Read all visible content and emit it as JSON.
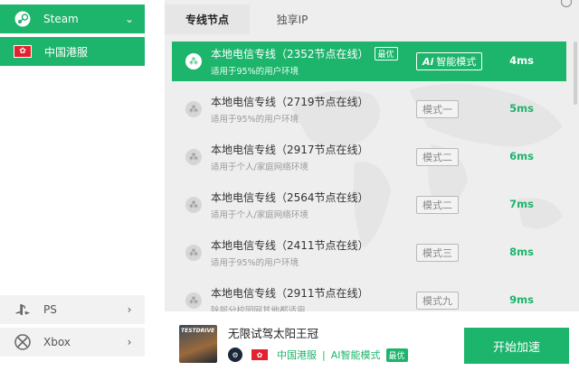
{
  "sidebar": {
    "items": [
      {
        "label": "Steam",
        "icon": "steam-icon",
        "chevron": "⌄"
      },
      {
        "label": "中国港服",
        "icon": "hk-flag-icon"
      },
      {
        "label": "PS",
        "icon": "playstation-icon",
        "chevron": "›"
      },
      {
        "label": "Xbox",
        "icon": "xbox-icon",
        "chevron": "›"
      }
    ]
  },
  "tabs": [
    {
      "label": "专线节点"
    },
    {
      "label": "独享IP"
    }
  ],
  "nodes": [
    {
      "title": "本地电信专线（2352节点在线）",
      "badge": "最优",
      "subtitle": "适用于95%的用户环境",
      "mode_ai": "Ai",
      "mode": "智能模式",
      "latency": "4ms"
    },
    {
      "title": "本地电信专线（2719节点在线）",
      "subtitle": "适用于95%的用户环境",
      "mode": "模式一",
      "latency": "5ms"
    },
    {
      "title": "本地电信专线（2917节点在线）",
      "subtitle": "适用于个人/家庭网络环境",
      "mode": "模式二",
      "latency": "6ms"
    },
    {
      "title": "本地电信专线（2564节点在线）",
      "subtitle": "适用于个人/家庭网络环境",
      "mode": "模式二",
      "latency": "7ms"
    },
    {
      "title": "本地电信专线（2411节点在线）",
      "subtitle": "适用于95%的用户环境",
      "mode": "模式三",
      "latency": "8ms"
    },
    {
      "title": "本地电信专线（2911节点在线）",
      "subtitle": "除部分校园网其他都适用",
      "mode": "模式九",
      "latency": "9ms"
    }
  ],
  "game": {
    "cover_text": "TESTDRIVE",
    "title": "无限试驾太阳王冠",
    "region": "中国港服",
    "separator": "|",
    "mode": "AI智能模式",
    "badge": "最优"
  },
  "start_button": "开始加速",
  "colors": {
    "accent": "#1db46b",
    "panel": "#eeeeee"
  }
}
